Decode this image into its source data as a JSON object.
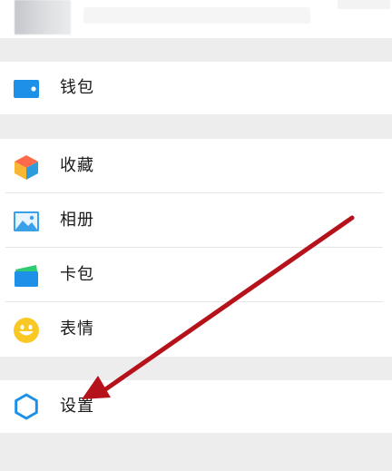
{
  "menu": {
    "items": [
      {
        "label": "钱包",
        "icon": "wallet-icon"
      },
      {
        "label": "收藏",
        "icon": "favorites-cube-icon"
      },
      {
        "label": "相册",
        "icon": "album-picture-icon"
      },
      {
        "label": "卡包",
        "icon": "card-holder-icon"
      },
      {
        "label": "表情",
        "icon": "sticker-smile-icon"
      },
      {
        "label": "设置",
        "icon": "settings-gear-icon"
      }
    ]
  },
  "colors": {
    "background": "#ededed",
    "row": "#ffffff",
    "text": "#1a1a1a",
    "accent_blue": "#1e90e8",
    "annotation_arrow": "#b5121b"
  }
}
